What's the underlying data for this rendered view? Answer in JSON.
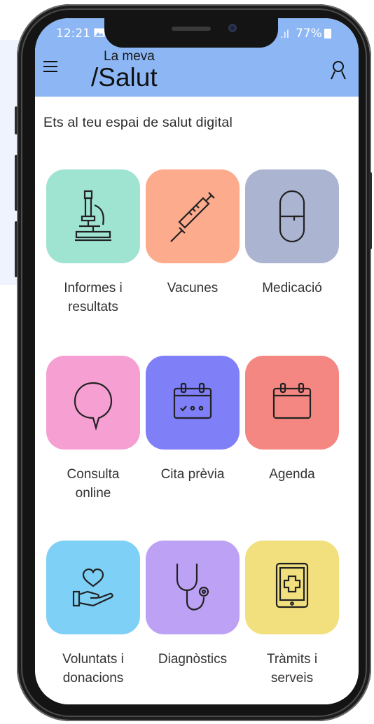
{
  "status_bar": {
    "time": "12:21",
    "signal": ".ıl",
    "battery": "77%"
  },
  "header": {
    "logo_top": "La meva",
    "logo_bottom": "/Salut",
    "menu_icon": "hamburger-menu-icon",
    "profile_icon": "user-icon"
  },
  "subtitle": "Ets al teu espai de salut digital",
  "colors": {
    "header": "#8cb7f4",
    "informes": "#9fe3d1",
    "vacunes": "#fcab8c",
    "medicacio": "#abb5d1",
    "consulta": "#f59fd2",
    "cita": "#7f7ff8",
    "agenda": "#f48781",
    "voluntats": "#7ed0f6",
    "diagnostics": "#bda1f5",
    "tramits": "#f2e07e"
  },
  "tiles": {
    "informes": {
      "line1": "Informes i",
      "line2": "resultats",
      "icon": "microscope-icon"
    },
    "vacunes": {
      "line1": "Vacunes",
      "icon": "syringe-icon"
    },
    "medicacio": {
      "line1": "Medicació",
      "icon": "pill-icon"
    },
    "consulta": {
      "line1": "Consulta",
      "line2": "online",
      "icon": "speech-bubble-icon"
    },
    "cita": {
      "line1": "Cita prèvia",
      "icon": "calendar-check-icon"
    },
    "agenda": {
      "line1": "Agenda",
      "icon": "calendar-icon"
    },
    "voluntats": {
      "line1": "Voluntats i",
      "line2": "donacions",
      "icon": "heart-hand-icon"
    },
    "diagnostics": {
      "line1": "Diagnòstics",
      "icon": "stethoscope-icon"
    },
    "tramits": {
      "line1": "Tràmits i",
      "line2": "serveis",
      "icon": "tablet-cross-icon"
    }
  }
}
